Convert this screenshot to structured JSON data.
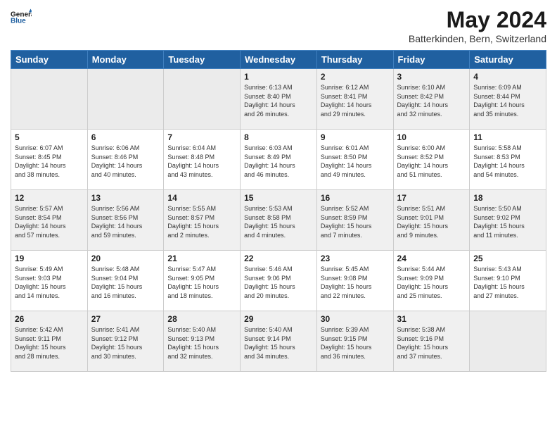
{
  "header": {
    "logo_line1": "General",
    "logo_line2": "Blue",
    "month_year": "May 2024",
    "location": "Batterkinden, Bern, Switzerland"
  },
  "weekdays": [
    "Sunday",
    "Monday",
    "Tuesday",
    "Wednesday",
    "Thursday",
    "Friday",
    "Saturday"
  ],
  "weeks": [
    [
      {
        "day": "",
        "info": ""
      },
      {
        "day": "",
        "info": ""
      },
      {
        "day": "",
        "info": ""
      },
      {
        "day": "1",
        "info": "Sunrise: 6:13 AM\nSunset: 8:40 PM\nDaylight: 14 hours\nand 26 minutes."
      },
      {
        "day": "2",
        "info": "Sunrise: 6:12 AM\nSunset: 8:41 PM\nDaylight: 14 hours\nand 29 minutes."
      },
      {
        "day": "3",
        "info": "Sunrise: 6:10 AM\nSunset: 8:42 PM\nDaylight: 14 hours\nand 32 minutes."
      },
      {
        "day": "4",
        "info": "Sunrise: 6:09 AM\nSunset: 8:44 PM\nDaylight: 14 hours\nand 35 minutes."
      }
    ],
    [
      {
        "day": "5",
        "info": "Sunrise: 6:07 AM\nSunset: 8:45 PM\nDaylight: 14 hours\nand 38 minutes."
      },
      {
        "day": "6",
        "info": "Sunrise: 6:06 AM\nSunset: 8:46 PM\nDaylight: 14 hours\nand 40 minutes."
      },
      {
        "day": "7",
        "info": "Sunrise: 6:04 AM\nSunset: 8:48 PM\nDaylight: 14 hours\nand 43 minutes."
      },
      {
        "day": "8",
        "info": "Sunrise: 6:03 AM\nSunset: 8:49 PM\nDaylight: 14 hours\nand 46 minutes."
      },
      {
        "day": "9",
        "info": "Sunrise: 6:01 AM\nSunset: 8:50 PM\nDaylight: 14 hours\nand 49 minutes."
      },
      {
        "day": "10",
        "info": "Sunrise: 6:00 AM\nSunset: 8:52 PM\nDaylight: 14 hours\nand 51 minutes."
      },
      {
        "day": "11",
        "info": "Sunrise: 5:58 AM\nSunset: 8:53 PM\nDaylight: 14 hours\nand 54 minutes."
      }
    ],
    [
      {
        "day": "12",
        "info": "Sunrise: 5:57 AM\nSunset: 8:54 PM\nDaylight: 14 hours\nand 57 minutes."
      },
      {
        "day": "13",
        "info": "Sunrise: 5:56 AM\nSunset: 8:56 PM\nDaylight: 14 hours\nand 59 minutes."
      },
      {
        "day": "14",
        "info": "Sunrise: 5:55 AM\nSunset: 8:57 PM\nDaylight: 15 hours\nand 2 minutes."
      },
      {
        "day": "15",
        "info": "Sunrise: 5:53 AM\nSunset: 8:58 PM\nDaylight: 15 hours\nand 4 minutes."
      },
      {
        "day": "16",
        "info": "Sunrise: 5:52 AM\nSunset: 8:59 PM\nDaylight: 15 hours\nand 7 minutes."
      },
      {
        "day": "17",
        "info": "Sunrise: 5:51 AM\nSunset: 9:01 PM\nDaylight: 15 hours\nand 9 minutes."
      },
      {
        "day": "18",
        "info": "Sunrise: 5:50 AM\nSunset: 9:02 PM\nDaylight: 15 hours\nand 11 minutes."
      }
    ],
    [
      {
        "day": "19",
        "info": "Sunrise: 5:49 AM\nSunset: 9:03 PM\nDaylight: 15 hours\nand 14 minutes."
      },
      {
        "day": "20",
        "info": "Sunrise: 5:48 AM\nSunset: 9:04 PM\nDaylight: 15 hours\nand 16 minutes."
      },
      {
        "day": "21",
        "info": "Sunrise: 5:47 AM\nSunset: 9:05 PM\nDaylight: 15 hours\nand 18 minutes."
      },
      {
        "day": "22",
        "info": "Sunrise: 5:46 AM\nSunset: 9:06 PM\nDaylight: 15 hours\nand 20 minutes."
      },
      {
        "day": "23",
        "info": "Sunrise: 5:45 AM\nSunset: 9:08 PM\nDaylight: 15 hours\nand 22 minutes."
      },
      {
        "day": "24",
        "info": "Sunrise: 5:44 AM\nSunset: 9:09 PM\nDaylight: 15 hours\nand 25 minutes."
      },
      {
        "day": "25",
        "info": "Sunrise: 5:43 AM\nSunset: 9:10 PM\nDaylight: 15 hours\nand 27 minutes."
      }
    ],
    [
      {
        "day": "26",
        "info": "Sunrise: 5:42 AM\nSunset: 9:11 PM\nDaylight: 15 hours\nand 28 minutes."
      },
      {
        "day": "27",
        "info": "Sunrise: 5:41 AM\nSunset: 9:12 PM\nDaylight: 15 hours\nand 30 minutes."
      },
      {
        "day": "28",
        "info": "Sunrise: 5:40 AM\nSunset: 9:13 PM\nDaylight: 15 hours\nand 32 minutes."
      },
      {
        "day": "29",
        "info": "Sunrise: 5:40 AM\nSunset: 9:14 PM\nDaylight: 15 hours\nand 34 minutes."
      },
      {
        "day": "30",
        "info": "Sunrise: 5:39 AM\nSunset: 9:15 PM\nDaylight: 15 hours\nand 36 minutes."
      },
      {
        "day": "31",
        "info": "Sunrise: 5:38 AM\nSunset: 9:16 PM\nDaylight: 15 hours\nand 37 minutes."
      },
      {
        "day": "",
        "info": ""
      }
    ]
  ]
}
